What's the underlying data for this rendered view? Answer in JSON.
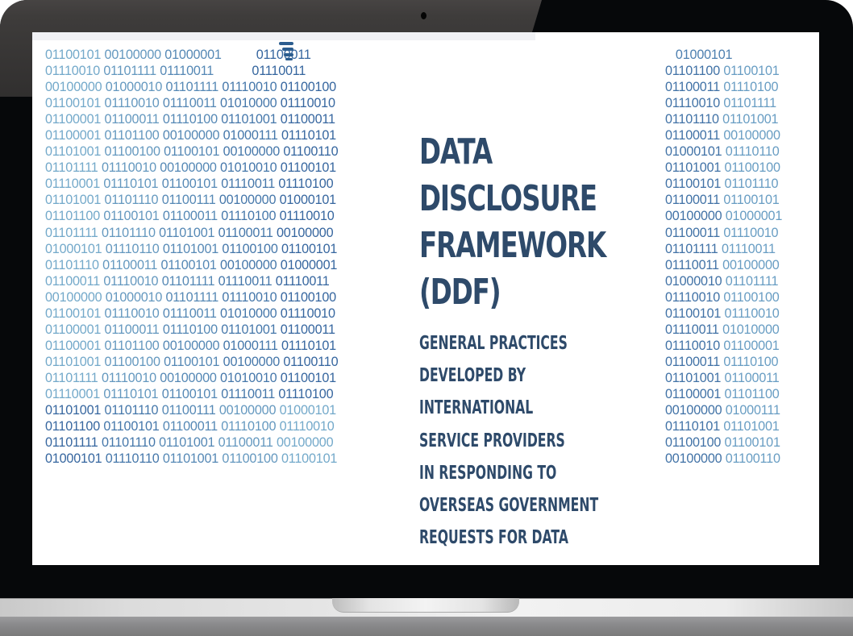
{
  "document": {
    "title_lines": [
      "DATA",
      "DISCLOSURE",
      "FRAMEWORK",
      "(DDF)"
    ],
    "subtitle_lines": [
      "GENERAL PRACTICES",
      "DEVELOPED BY",
      "INTERNATIONAL",
      "SERVICE PROVIDERS",
      "IN RESPONDING TO",
      "OVERSEAS GOVERNMENT",
      "REQUESTS FOR DATA"
    ],
    "logo_icon": "stacked-bars-logo-icon"
  },
  "colors": {
    "title": "#2e4a6a",
    "binary_light": "#7ab0cf",
    "binary_dark": "#2f5f9a",
    "logo": "#2c5d8f",
    "bezel": "#06080a",
    "screen": "#ffffff"
  },
  "binary_left": [
    "01100101 00100000 01000001          01100011",
    "01110010 01101111 01110011           01110011",
    "00100000 01000010 01101111 01110010 01100100",
    "01100101 01110010 01110011 01010000 01110010",
    "01100001 01100011 01110100 01101001 01100011",
    "01100001 01101100 00100000 01000111 01110101",
    "01101001 01100100 01100101 00100000 01100110",
    "01101111 01110010 00100000 01010010 01100101",
    "01110001 01110101 01100101 01110011 01110100",
    "01101001 01101110 01100111 00100000 01000101",
    "01101100 01100101 01100011 01110100 01110010",
    "01101111 01101110 01101001 01100011 00100000",
    "01000101 01110110 01101001 01100100 01100101",
    "01101110 01100011 01100101 00100000 01000001",
    "01100011 01110010 01101111 01110011 01110011",
    "00100000 01000010 01101111 01110010 01100100",
    "01100101 01110010 01110011 01010000 01110010",
    "01100001 01100011 01110100 01101001 01100011",
    "01100001 01101100 00100000 01000111 01110101",
    "01101001 01100100 01100101 00100000 01100110",
    "01101111 01110010 00100000 01010010 01100101",
    "01110001 01110101 01100101 01110011 01110100",
    "01101001 01101110 01100111 00100000 01000101",
    "01101100 01100101 01100011 01110100 01110010",
    "01101111 01101110 01101001 01100011 00100000",
    "01000101 01110110 01101001 01100100 01100101"
  ],
  "binary_right": [
    "   01000101",
    "01101100 01100101",
    "01100011 01110100",
    "01110010 01101111",
    "01101110 01101001",
    "01100011 00100000",
    "01000101 01110110",
    "01101001 01100100",
    "01100101 01101110",
    "01100011 01100101",
    "00100000 01000001",
    "01100011 01110010",
    "01101111 01110011",
    "01110011 00100000",
    "01000010 01101111",
    "01110010 01100100",
    "01100101 01110010",
    "01110011 01010000",
    "01110010 01100001",
    "01100011 01110100",
    "01101001 01100011",
    "01100001 01101100",
    "00100000 01000111",
    "01110101 01101001",
    "01100100 01100101",
    "00100000 01100110"
  ]
}
